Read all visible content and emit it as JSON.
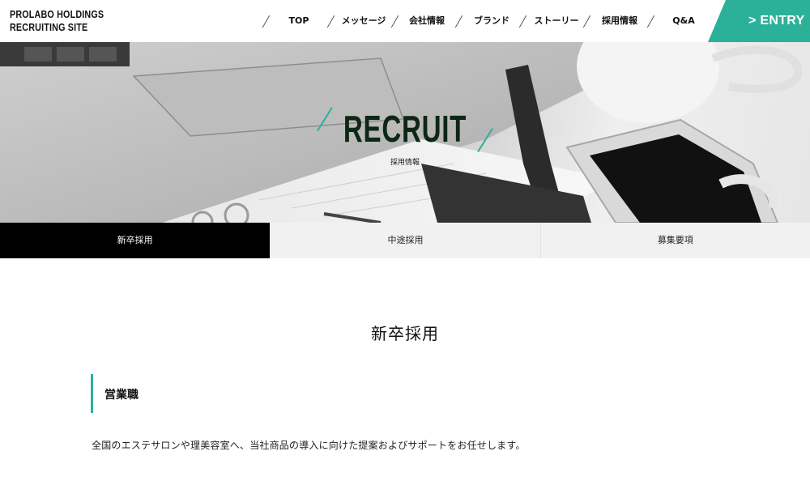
{
  "header": {
    "logo_line1": "PROLABO HOLDINGS",
    "logo_line2": "RECRUITING SITE",
    "nav": [
      {
        "label": "TOP"
      },
      {
        "label": "メッセージ"
      },
      {
        "label": "会社情報"
      },
      {
        "label": "ブランド"
      },
      {
        "label": "ストーリー"
      },
      {
        "label": "採用情報"
      },
      {
        "label": "Q&A"
      }
    ],
    "entry_label": "> ENTRY"
  },
  "hero": {
    "title": "RECRUIT",
    "subtitle": "採用情報"
  },
  "tabs": [
    {
      "label": "新卒採用",
      "active": true
    },
    {
      "label": "中途採用",
      "active": false
    },
    {
      "label": "募集要項",
      "active": false
    }
  ],
  "content": {
    "section_title": "新卒採用",
    "job_title": "営業職",
    "description": "全国のエステサロンや理美容室へ、当社商品の導入に向けた提案およびサポートをお任せします。"
  },
  "colors": {
    "accent": "#2bb19a",
    "hero_title": "#0e2616",
    "active_tab": "#000000"
  }
}
